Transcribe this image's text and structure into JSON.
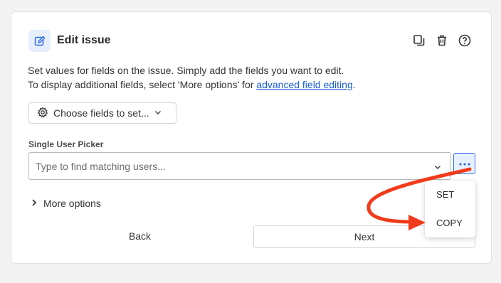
{
  "dialog": {
    "title": "Edit issue",
    "description_line1": "Set values for fields on the issue. Simply add the fields you want to edit.",
    "description_line2_prefix": "To display additional fields, select 'More options' for ",
    "description_link": "advanced field editing",
    "description_line2_suffix": "."
  },
  "header_icons": [
    "copy-icon",
    "trash-icon",
    "help-icon"
  ],
  "choose_fields": {
    "label": "Choose fields to set..."
  },
  "field": {
    "label": "Single User Picker",
    "placeholder": "Type to find matching users...",
    "value": ""
  },
  "more_options": {
    "label": "More options"
  },
  "buttons": {
    "back": "Back",
    "next": "Next"
  },
  "menu": {
    "items": [
      "SET",
      "COPY"
    ]
  },
  "colors": {
    "accent": "#2f6fe0",
    "link": "#1a5fd6",
    "annotation_arrow": "#f23b1a"
  }
}
